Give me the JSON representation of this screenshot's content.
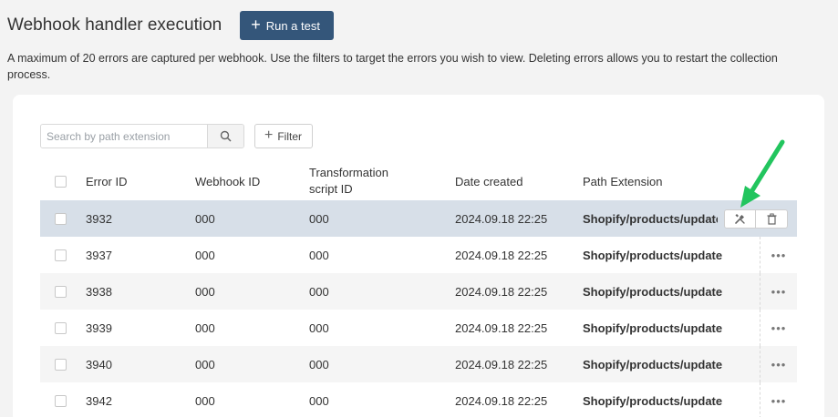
{
  "header": {
    "title": "Webhook handler execution",
    "run_test_label": "Run a test"
  },
  "description": "A maximum of 20 errors are captured per webhook. Use the filters to target the errors you wish to view. Deleting errors allows you to restart the collection process.",
  "toolbar": {
    "search_placeholder": "Search by path extension",
    "filter_label": "Filter"
  },
  "table": {
    "columns": {
      "error_id": "Error ID",
      "webhook_id": "Webhook ID",
      "transformation_script_id": "Transformation script ID",
      "date_created": "Date created",
      "path_extension": "Path Extension"
    },
    "rows": [
      {
        "error_id": "3932",
        "webhook_id": "000",
        "script_id": "000",
        "date": "2024.09.18 22:25",
        "path": "Shopify/products/update"
      },
      {
        "error_id": "3937",
        "webhook_id": "000",
        "script_id": "000",
        "date": "2024.09.18 22:25",
        "path": "Shopify/products/update"
      },
      {
        "error_id": "3938",
        "webhook_id": "000",
        "script_id": "000",
        "date": "2024.09.18 22:25",
        "path": "Shopify/products/update"
      },
      {
        "error_id": "3939",
        "webhook_id": "000",
        "script_id": "000",
        "date": "2024.09.18 22:25",
        "path": "Shopify/products/update"
      },
      {
        "error_id": "3940",
        "webhook_id": "000",
        "script_id": "000",
        "date": "2024.09.18 22:25",
        "path": "Shopify/products/update"
      },
      {
        "error_id": "3942",
        "webhook_id": "000",
        "script_id": "000",
        "date": "2024.09.18 22:25",
        "path": "Shopify/products/update"
      }
    ],
    "more_label": "•••"
  },
  "icons": {
    "search": "search-icon",
    "plus": "plus-icon",
    "tools": "tools-icon",
    "trash": "trash-icon",
    "more": "more-horizontal-icon",
    "annotation_arrow": "arrow-annotation-icon"
  },
  "colors": {
    "primary": "#34567a",
    "hover_row": "#d7dfe8",
    "alt_row": "#f5f5f5",
    "annotation": "#22c55e"
  }
}
